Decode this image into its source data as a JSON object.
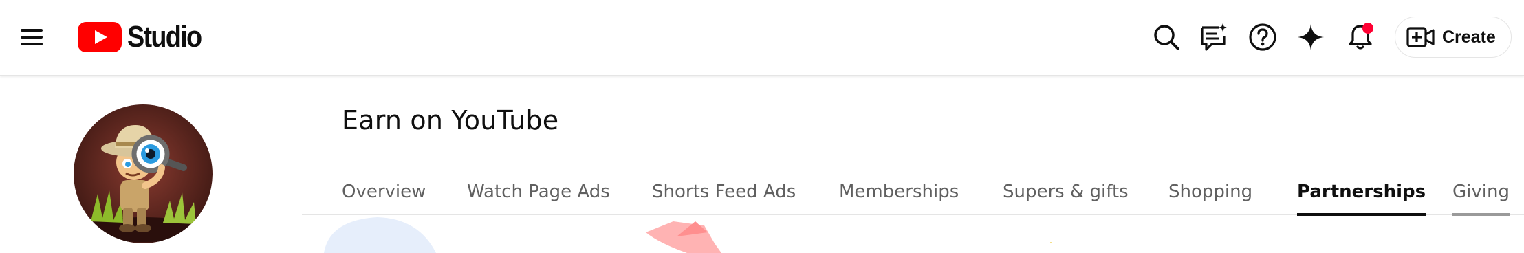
{
  "app": {
    "logo_text": "Studio",
    "brand_red": "#FF0000"
  },
  "header": {
    "icons": [
      "menu-icon",
      "search-icon",
      "feedback-icon",
      "help-icon",
      "sparkle-icon",
      "notifications-icon"
    ],
    "notification_dot_color": "#FF0033",
    "create_label": "Create"
  },
  "page": {
    "title": "Earn on YouTube"
  },
  "tabs": [
    {
      "label": "Overview",
      "active": false
    },
    {
      "label": "Watch Page Ads",
      "active": false
    },
    {
      "label": "Shorts Feed Ads",
      "active": false
    },
    {
      "label": "Memberships",
      "active": false
    },
    {
      "label": "Supers & gifts",
      "active": false
    },
    {
      "label": "Shopping",
      "active": false
    },
    {
      "label": "Partnerships",
      "active": true
    },
    {
      "label": "Giving",
      "active": false
    }
  ]
}
